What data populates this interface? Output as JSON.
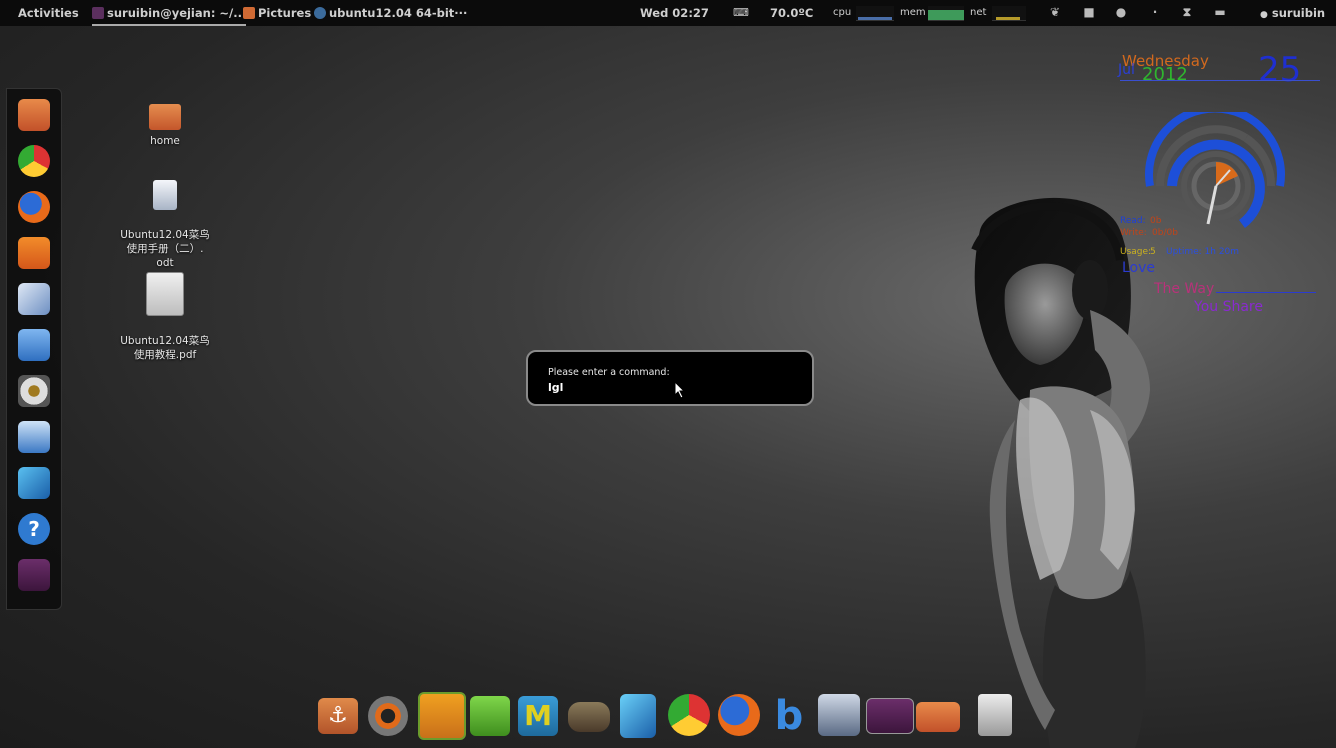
{
  "topbar": {
    "activities": "Activities",
    "windows": [
      {
        "label": "suruibin@yejian: ~/...",
        "color": "#5b2f5e"
      },
      {
        "label": "Pictures",
        "color": "#d06a34"
      },
      {
        "label": "ubuntu12.04 64-bit···",
        "color": "#3b6b9c"
      }
    ],
    "clock": "Wed 02:27",
    "temperature": "70.0ºC",
    "cpu_label": "cpu",
    "mem_label": "mem",
    "net_label": "net",
    "user": "suruibin"
  },
  "desktop": {
    "icons": [
      {
        "label": "home"
      },
      {
        "label": "Ubuntu12.04菜鸟\n使用手册（二）.\nodt"
      },
      {
        "label": "Ubuntu12.04菜鸟\n使用教程.pdf"
      }
    ]
  },
  "run_dialog": {
    "prompt": "Please enter a command:",
    "value": "lgl"
  },
  "conky": {
    "day": "Wednesday",
    "month": "Jul",
    "year": "2012",
    "date": "25",
    "read_label": "Read:",
    "read_value": "0b",
    "write_label": "Write:",
    "write_value": "0b/0b",
    "usage_label": "Usage:",
    "usage_value": "5",
    "uptime": "Uptime: 1h 20m",
    "quote_1": "Love",
    "quote_2": "The Way",
    "quote_3": "You Share"
  },
  "left_dock": [
    "home-folder-icon",
    "chrome-icon",
    "firefox-icon",
    "software-center-icon",
    "mail-icon",
    "chat-icon",
    "audio-icon",
    "image-viewer-icon",
    "document-icon",
    "help-icon",
    "terminal-icon"
  ],
  "bottom_dock": [
    "anchor-icon",
    "settings-icon",
    "pidgin-icon",
    "software-icon",
    "m-icon",
    "gimp-icon",
    "document-icon",
    "chrome-icon",
    "firefox-icon",
    "b-icon",
    "video-icon",
    "terminal-icon",
    "home-folder-icon",
    "trash-icon"
  ]
}
